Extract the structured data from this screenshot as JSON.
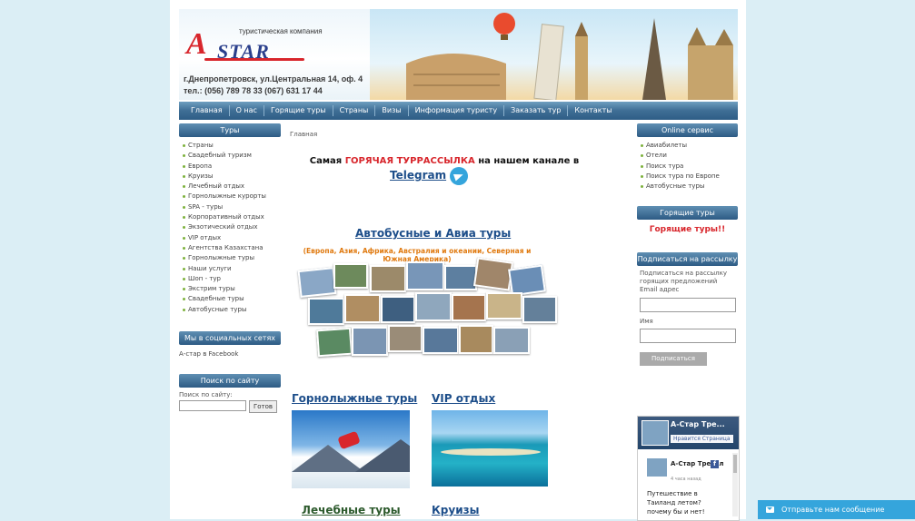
{
  "header": {
    "logo_tagline": "туристическая компания",
    "logo_a": "A",
    "logo_star": "STAR",
    "address": "г.Днепропетровск, ул.Центральная 14, оф. 4",
    "phones": "тел.: (056) 789 78 33   (067) 631 17 44"
  },
  "nav": {
    "items": [
      "Главная",
      "О нас",
      "Горящие туры",
      "Страны",
      "Визы",
      "Информация туристу",
      "Заказать тур",
      "Контакты"
    ]
  },
  "left": {
    "tours_title": "Туры",
    "tours": [
      "Страны",
      "Свадебный туризм",
      "Европа",
      "Круизы",
      "Лечебный отдых",
      "Горнолыжные курорты",
      "SPA - туры",
      "Корпоративный отдых",
      "Экзотический отдых",
      "VIP отдых",
      "Агентства Казахстана",
      "Горнолыжные туры",
      "Наши услуги",
      "Шоп - тур",
      "Экстрим туры",
      "Свадебные туры",
      "Автобусные туры"
    ],
    "social_title": "Мы в социальных сетях",
    "facebook_alt": "А-стар в Facebook",
    "search_title": "Поиск по сайту",
    "search_label": "Поиск по сайту:",
    "search_button": "Готов"
  },
  "center": {
    "breadcrumb": "Главная",
    "promo_before": "Самая ",
    "promo_hot": "ГОРЯЧАЯ ТУРРАССЫЛКА",
    "promo_after": " на нашем канале в",
    "telegram": "Telegram",
    "bus_title": "Автобусные и Авиа туры",
    "bus_sub": "(Европа, Азия, Африка, Австралия и океании, Северная и Южная Америка)",
    "ski_title": "Горнолыжные туры",
    "vip_title": "VIP отдых",
    "med_title": "Лечебные туры",
    "cruise_title": "Круизы"
  },
  "right": {
    "online_title": "Online сервис",
    "online_items": [
      "Авиабилеты",
      "Отели",
      "Поиск тура",
      "Поиск тура по Европе",
      "Автобусные туры"
    ],
    "hot_title": "Горящие туры",
    "hot_link": "Горящие туры!!",
    "subscribe_title": "Подписаться на рассылку",
    "subscribe_text": "Подписаться на рассылку горящих предложений",
    "email_label": "Email адрес",
    "name_label": "Имя",
    "subscribe_button": "Подписаться",
    "fb_page_name": "А-Стар Тре...",
    "fb_like": "Нравится Страница",
    "fb_post_name": "А-Стар Тревел",
    "fb_post_date": "4 часа назад",
    "fb_post_text": "Путешествие в Таиланд летом? почему бы и нет!"
  },
  "chat": {
    "label": "Отправьте нам сообщение"
  }
}
